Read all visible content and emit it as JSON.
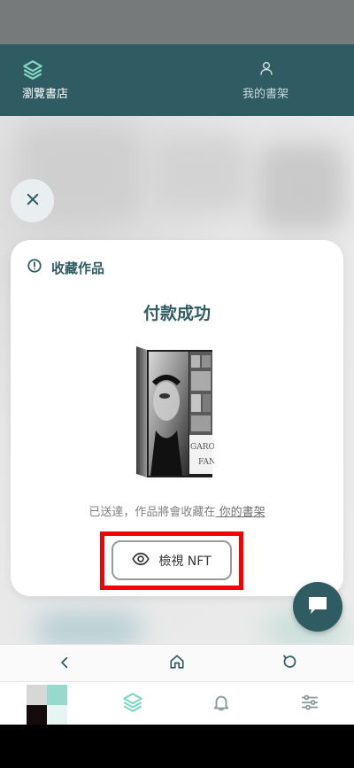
{
  "top_tabs": {
    "browse_label": "瀏覽書店",
    "my_shelf_label": "我的書架"
  },
  "modal": {
    "header_title": "收藏作品",
    "success_title": "付款成功",
    "delivered_prefix": "已送達，作品將會收藏在",
    "shelf_link": " 你的書架",
    "view_nft_label": "檢視 NFT"
  },
  "book_cover": {
    "spine_text_1": "GARO",
    "spine_text_2": "FAN"
  },
  "icons": {
    "close": "close-icon",
    "info": "info-icon",
    "eye": "eye-icon",
    "chat": "chat-icon",
    "layers": "layers-icon",
    "user": "user-icon",
    "back": "back-arrow-icon",
    "home": "home-icon",
    "reload": "reload-icon",
    "bell": "bell-icon",
    "settings": "sliders-icon"
  },
  "colors": {
    "brand": "#2f5c62",
    "accent": "#7fd8c2",
    "highlight": "#f30000"
  }
}
